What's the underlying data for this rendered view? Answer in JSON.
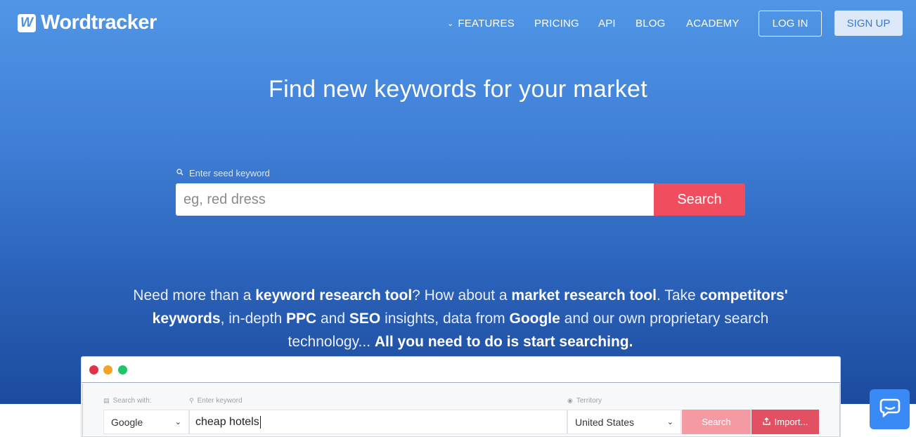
{
  "brand": {
    "logo_letter": "W",
    "name": "Wordtracker"
  },
  "nav": {
    "items": [
      "FEATURES",
      "PRICING",
      "API",
      "BLOG",
      "ACADEMY"
    ],
    "login": "LOG IN",
    "signup": "SIGN UP"
  },
  "hero": {
    "headline": "Find new keywords for your market",
    "seed_label": "Enter seed keyword",
    "seed_placeholder": "eg, red dress",
    "search_button": "Search"
  },
  "tagline": {
    "segments": [
      {
        "text": "Need more than a ",
        "bold": false
      },
      {
        "text": "keyword research tool",
        "bold": true
      },
      {
        "text": "? How about a ",
        "bold": false
      },
      {
        "text": "market research tool",
        "bold": true
      },
      {
        "text": ". Take ",
        "bold": false
      },
      {
        "text": "competitors' keywords",
        "bold": true
      },
      {
        "text": ", in-depth ",
        "bold": false
      },
      {
        "text": "PPC",
        "bold": true
      },
      {
        "text": " and ",
        "bold": false
      },
      {
        "text": "SEO",
        "bold": true
      },
      {
        "text": " insights, data from ",
        "bold": false
      },
      {
        "text": "Google",
        "bold": true
      },
      {
        "text": " and our own proprietary search technology... ",
        "bold": false
      },
      {
        "text": "All you need to do is start searching.",
        "bold": true
      }
    ]
  },
  "mock": {
    "search_with_label": "Search with:",
    "engine_value": "Google",
    "keyword_label": "Enter keyword",
    "keyword_value": "cheap hotels",
    "territory_label": "Territory",
    "territory_value": "United States",
    "search_button": "Search",
    "import_button": "Import..."
  },
  "colors": {
    "hero_top": "#5196e6",
    "hero_bottom": "#1c4b9d",
    "accent_red": "#f04d5e",
    "chat_blue": "#3a8af5"
  },
  "icons": [
    "search-icon",
    "chevron-down-icon",
    "chat-icon",
    "upload-icon",
    "globe-icon",
    "list-icon"
  ]
}
